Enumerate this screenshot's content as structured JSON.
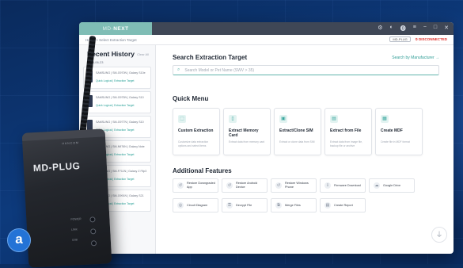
{
  "window": {
    "brand_prefix": "MD-",
    "brand_name": "NEXT"
  },
  "titlebar": {
    "controls": [
      "⚙",
      "◐",
      "⓿",
      "≡",
      "−",
      "□",
      "✕"
    ]
  },
  "toolbar": {
    "breadcrumb": "Home  >  Select Extraction Target",
    "mdplug_label": "MD-PLUG",
    "connection_status": "DISCONNECTED"
  },
  "sidebar": {
    "title": "Recent History",
    "clear_label": "Clear All",
    "date": "2023-06-23",
    "items": [
      {
        "meta": "SAMSUNG | SM-G970N | Galaxy S10e",
        "tag": "Quick Logical | Extraction Target"
      },
      {
        "meta": "SAMSUNG | SM-G975N | Galaxy S10",
        "tag": "Quick Logical | Extraction Target"
      },
      {
        "meta": "SAMSUNG | SM-G977N | Galaxy S10",
        "tag": "Quick Logical | Extraction Target"
      },
      {
        "meta": "SAMSUNG | SM-N976N | Galaxy Note",
        "tag": "Quick Logical | Extraction Target"
      },
      {
        "meta": "SAMSUNG | SM-F711N | Galaxy Z Flip3",
        "tag": "Quick Logical | Extraction Target"
      },
      {
        "meta": "SAMSUNG | SM-G991N | Galaxy S21",
        "tag": "Quick Logical | Extraction Target"
      }
    ]
  },
  "search": {
    "title": "Search Extraction Target",
    "manufacturer_link": "Search by Manufacturer →",
    "placeholder": "Search Model or Pet Name (SWV > 35)"
  },
  "quick_menu": {
    "title": "Quick Menu",
    "cards": [
      {
        "icon": "⬚",
        "name": "Custom Extraction",
        "desc": "Customize data extraction options and select items"
      },
      {
        "icon": "▯",
        "name": "Extract Memory Card",
        "desc": "Extract data from memory card"
      },
      {
        "icon": "▣",
        "name": "Extract/Clone SIM",
        "desc": "Extract or clone data from SIM"
      },
      {
        "icon": "▤",
        "name": "Extract from File",
        "desc": "Extract data from image file, backup file or archive"
      },
      {
        "icon": "▦",
        "name": "Create MDF",
        "desc": "Create file in MDF format"
      }
    ]
  },
  "additional": {
    "title": "Additional Features",
    "items": [
      {
        "icon": "↺",
        "label": "Restore Downgraded App"
      },
      {
        "icon": "↺",
        "label": "Restore Android Device"
      },
      {
        "icon": "↺",
        "label": "Restore Windows Phone"
      },
      {
        "icon": "⇩",
        "label": "Firmware Download"
      },
      {
        "icon": "☁",
        "label": "Google Drive"
      },
      {
        "icon": "◎",
        "label": "Circuit Diagram"
      },
      {
        "icon": "⚿",
        "label": "Decrypt File"
      },
      {
        "icon": "⧉",
        "label": "Merge Files"
      },
      {
        "icon": "▤",
        "label": "Create Report"
      }
    ]
  },
  "device": {
    "label": "MD-PLUG",
    "brandmark": "HANCOM",
    "port_labels": [
      "POWER",
      "LINK",
      "USB"
    ]
  },
  "badge": {
    "letter": "a"
  },
  "usb_icon": "⏚"
}
